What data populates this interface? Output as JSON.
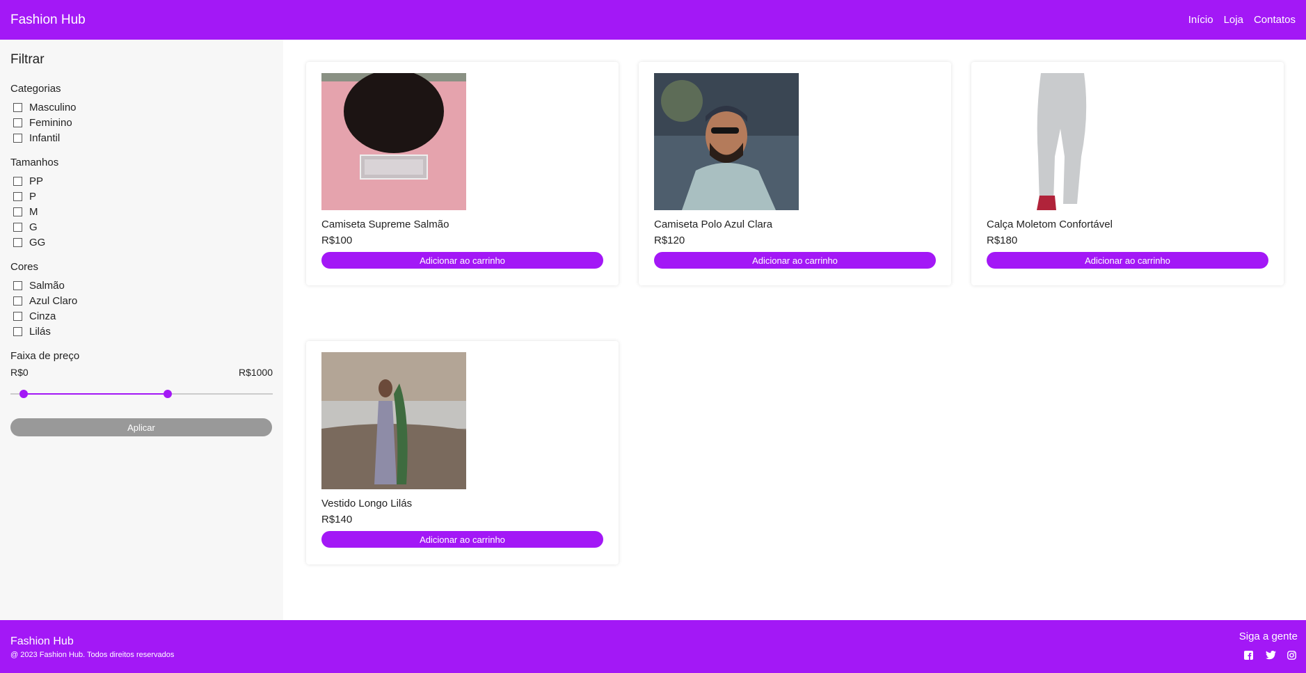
{
  "header": {
    "brand": "Fashion Hub",
    "nav": [
      "Início",
      "Loja",
      "Contatos"
    ]
  },
  "sidebar": {
    "title": "Filtrar",
    "categories": {
      "title": "Categorias",
      "options": [
        "Masculino",
        "Feminino",
        "Infantil"
      ]
    },
    "sizes": {
      "title": "Tamanhos",
      "options": [
        "PP",
        "P",
        "M",
        "G",
        "GG"
      ]
    },
    "colors": {
      "title": "Cores",
      "options": [
        "Salmão",
        "Azul Claro",
        "Cinza",
        "Lilás"
      ]
    },
    "price": {
      "title": "Faixa de preço",
      "min_label": "R$0",
      "max_label": "R$1000",
      "range_low_fraction": 0.05,
      "range_high_fraction": 0.6
    },
    "apply_label": "Aplicar"
  },
  "products": [
    {
      "name": "Camiseta Supreme Salmão",
      "price": "R$100",
      "button": "Adicionar ao carrinho"
    },
    {
      "name": "Camiseta Polo Azul Clara",
      "price": "R$120",
      "button": "Adicionar ao carrinho"
    },
    {
      "name": "Calça Moletom Confortável",
      "price": "R$180",
      "button": "Adicionar ao carrinho"
    },
    {
      "name": "Vestido Longo Lilás",
      "price": "R$140",
      "button": "Adicionar ao carrinho"
    }
  ],
  "footer": {
    "brand": "Fashion Hub",
    "copyright": "@ 2023 Fashion Hub. Todos direitos reservados",
    "follow": "Siga a gente",
    "social_icons": [
      "facebook-icon",
      "twitter-icon",
      "instagram-icon"
    ]
  },
  "colors": {
    "accent": "#a318f6",
    "sidebar_bg": "#f7f7f7",
    "apply_disabled": "#999999"
  }
}
